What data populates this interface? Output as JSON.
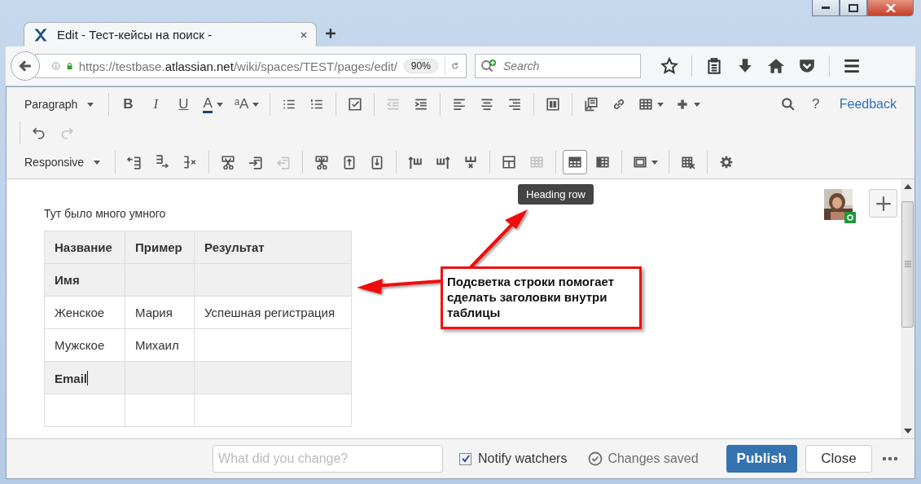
{
  "window": {
    "tab_title": "Edit - Тест-кейсы на поиск -"
  },
  "address_bar": {
    "url_start": "https://testbase.",
    "url_domain": "atlassian.net",
    "url_path": "/wiki/spaces/TEST/pages/edit/",
    "zoom": "90%"
  },
  "search": {
    "placeholder": "Search"
  },
  "toolbar": {
    "format_row": [
      {
        "kind": "dropdown",
        "label": "Paragraph"
      },
      {
        "kind": "separator"
      },
      {
        "kind": "text",
        "label": "B",
        "disabled": false,
        "selected": false
      },
      {
        "kind": "text",
        "label": "I",
        "disabled": false,
        "selected": false
      },
      {
        "kind": "text",
        "label": "U",
        "disabled": false,
        "selected": false
      },
      {
        "kind": "text",
        "label": "A",
        "disabled": false,
        "selected": false
      },
      {
        "kind": "text",
        "label": "ᵃA",
        "disabled": false,
        "selected": false
      },
      {
        "kind": "separator"
      },
      {
        "kind": "icon",
        "disabled": false,
        "selected": false
      },
      {
        "kind": "icon",
        "disabled": false,
        "selected": false
      },
      {
        "kind": "separator"
      },
      {
        "kind": "icon",
        "disabled": false,
        "selected": false
      },
      {
        "kind": "separator"
      },
      {
        "kind": "icon",
        "disabled": true,
        "selected": false
      },
      {
        "kind": "icon",
        "disabled": false,
        "selected": false
      },
      {
        "kind": "separator"
      },
      {
        "kind": "icon",
        "disabled": false,
        "selected": false
      },
      {
        "kind": "icon",
        "disabled": false,
        "selected": false
      },
      {
        "kind": "icon",
        "disabled": false,
        "selected": false
      },
      {
        "kind": "separator"
      },
      {
        "kind": "icon",
        "disabled": false,
        "selected": false
      },
      {
        "kind": "separator"
      },
      {
        "kind": "icon",
        "disabled": false,
        "selected": false
      },
      {
        "kind": "icon",
        "disabled": false,
        "selected": false
      },
      {
        "kind": "icon",
        "disabled": false,
        "selected": false
      },
      {
        "kind": "icon",
        "disabled": false,
        "selected": false
      },
      {
        "kind": "spacer"
      },
      {
        "kind": "icon",
        "disabled": false,
        "selected": false
      },
      {
        "kind": "text",
        "label": "?",
        "disabled": false,
        "selected": false
      },
      {
        "kind": "link",
        "label": "Feedback"
      }
    ],
    "history_row": [
      {
        "kind": "separator"
      },
      {
        "kind": "icon",
        "disabled": false,
        "selected": false
      },
      {
        "kind": "icon",
        "disabled": true,
        "selected": false
      }
    ],
    "table_row": [
      {
        "kind": "dropdown",
        "label": "Responsive"
      },
      {
        "kind": "separator"
      },
      {
        "kind": "icon",
        "disabled": false,
        "selected": false
      },
      {
        "kind": "icon",
        "disabled": false,
        "selected": false
      },
      {
        "kind": "icon",
        "disabled": false,
        "selected": false
      },
      {
        "kind": "separator"
      },
      {
        "kind": "icon",
        "disabled": false,
        "selected": false
      },
      {
        "kind": "icon",
        "disabled": false,
        "selected": false
      },
      {
        "kind": "icon",
        "disabled": true,
        "selected": false
      },
      {
        "kind": "separator"
      },
      {
        "kind": "icon",
        "disabled": false,
        "selected": false
      },
      {
        "kind": "icon",
        "disabled": false,
        "selected": false
      },
      {
        "kind": "icon",
        "disabled": false,
        "selected": false
      },
      {
        "kind": "separator"
      },
      {
        "kind": "icon",
        "disabled": false,
        "selected": false
      },
      {
        "kind": "icon",
        "disabled": false,
        "selected": false
      },
      {
        "kind": "icon",
        "disabled": false,
        "selected": false
      },
      {
        "kind": "separator"
      },
      {
        "kind": "icon",
        "disabled": false,
        "selected": false
      },
      {
        "kind": "icon",
        "disabled": true,
        "selected": false
      },
      {
        "kind": "separator"
      },
      {
        "kind": "icon",
        "disabled": false,
        "selected": true
      },
      {
        "kind": "icon",
        "disabled": false,
        "selected": false
      },
      {
        "kind": "separator"
      },
      {
        "kind": "icon",
        "disabled": false,
        "selected": false
      },
      {
        "kind": "separator"
      },
      {
        "kind": "icon",
        "disabled": false,
        "selected": false
      },
      {
        "kind": "separator"
      },
      {
        "kind": "icon",
        "disabled": false,
        "selected": false
      }
    ]
  },
  "tooltip": "Heading row",
  "page": {
    "paragraph": "Тут было много умного",
    "table": {
      "rows": [
        {
          "heading": true,
          "cursor": false,
          "cells": [
            "Название",
            "Пример",
            "Результат"
          ]
        },
        {
          "heading": true,
          "cursor": false,
          "cells": [
            "Имя"
          ]
        },
        {
          "heading": false,
          "cursor": false,
          "cells": [
            "Женское",
            "Мария",
            "Успешная регистрация"
          ]
        },
        {
          "heading": false,
          "cursor": false,
          "cells": [
            "Мужское",
            "Михаил"
          ]
        },
        {
          "heading": true,
          "cursor": true,
          "cells": [
            "Email"
          ]
        },
        {
          "heading": false,
          "cursor": false
        }
      ]
    }
  },
  "annotation": "Подсветка строки помогает сделать заголовки внутри таблицы",
  "footer": {
    "comment_placeholder": "What did you change?",
    "notify": {
      "label": "Notify watchers",
      "checked": true
    },
    "status": "Changes saved",
    "buttons": [
      {
        "kind": "primary",
        "label": "Publish"
      },
      {
        "kind": "default",
        "label": "Close"
      }
    ]
  }
}
